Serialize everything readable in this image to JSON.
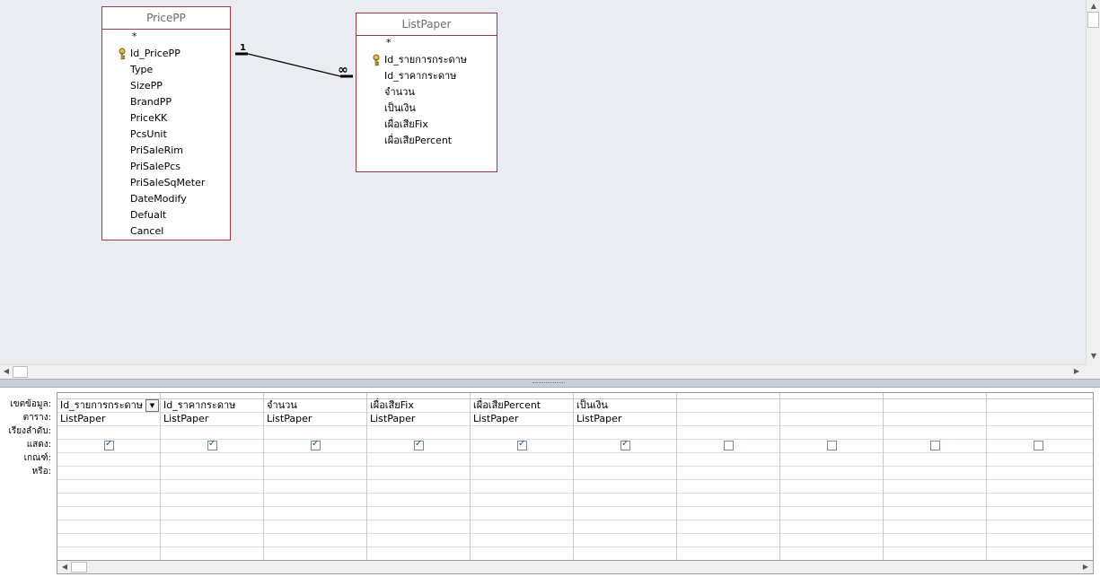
{
  "diagram": {
    "tables": [
      {
        "name": "PricePP",
        "fields": [
          "*",
          "Id_PricePP",
          "Type",
          "SizePP",
          "BrandPP",
          "PriceKK",
          "PcsUnit",
          "PriSaleRim",
          "PriSalePcs",
          "PriSaleSqMeter",
          "DateModify",
          "Defualt",
          "Cancel"
        ],
        "key_field": "Id_PricePP"
      },
      {
        "name": "ListPaper",
        "fields": [
          "*",
          "Id_รายการกระดาษ",
          "Id_ราคากระดาษ",
          "จำนวน",
          "เป็นเงิน",
          "เผื่อเสียFix",
          "เผื่อเสียPercent"
        ],
        "key_field": "Id_รายการกระดาษ"
      }
    ],
    "relationship": {
      "one_label": "1",
      "many_label": "∞"
    }
  },
  "grid": {
    "row_labels": [
      "เขตข้อมูล:",
      "ตาราง:",
      "เรียงลำดับ:",
      "แสดง:",
      "เกณฑ์:",
      "หรือ:"
    ],
    "columns": [
      {
        "field": "Id_รายการกระดาษ",
        "table": "ListPaper",
        "show": true
      },
      {
        "field": "Id_ราคากระดาษ",
        "table": "ListPaper",
        "show": true
      },
      {
        "field": "จำนวน",
        "table": "ListPaper",
        "show": true
      },
      {
        "field": "เผื่อเสียFix",
        "table": "ListPaper",
        "show": true
      },
      {
        "field": "เผื่อเสียPercent",
        "table": "ListPaper",
        "show": true
      },
      {
        "field": "เป็นเงิน",
        "table": "ListPaper",
        "show": true
      },
      {
        "field": "",
        "table": "",
        "show": false
      },
      {
        "field": "",
        "table": "",
        "show": false
      },
      {
        "field": "",
        "table": "",
        "show": false
      },
      {
        "field": "",
        "table": "",
        "show": false
      }
    ]
  },
  "icons": {
    "key": "key-icon",
    "dropdown": "chevron-down-icon",
    "scroll_left": "scroll-left-icon",
    "scroll_right": "scroll-right-icon",
    "scroll_up": "scroll-up-icon",
    "scroll_down": "scroll-down-icon"
  },
  "colors": {
    "table_border": "#a23a45",
    "diagram_bg": "#e9ecf0",
    "check": "#1f4e8c"
  }
}
